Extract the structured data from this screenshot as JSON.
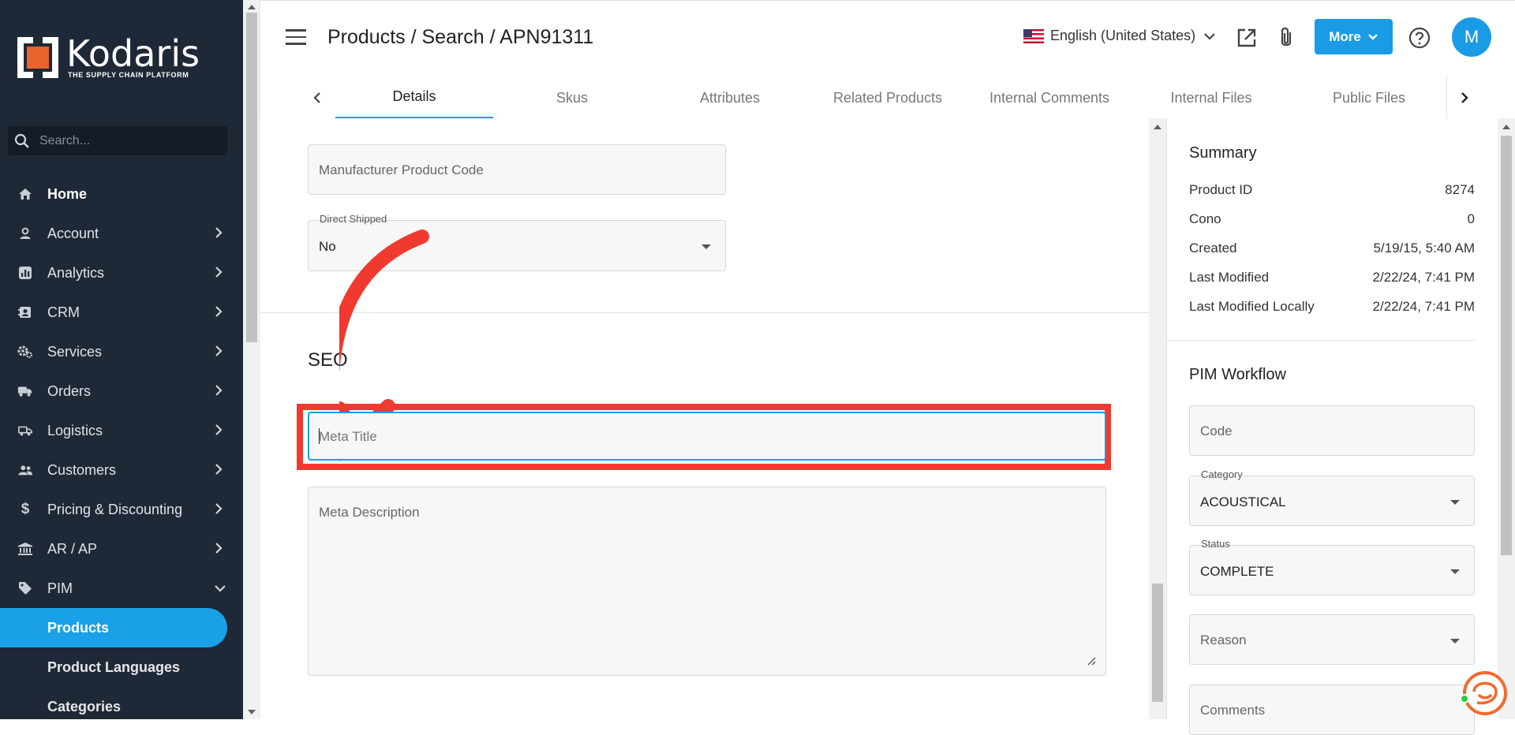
{
  "sidebar": {
    "brand": "Kodaris",
    "tagline": "THE SUPPLY CHAIN PLATFORM",
    "search_placeholder": "Search...",
    "items": [
      {
        "label": "Home",
        "icon": "home-icon"
      },
      {
        "label": "Account",
        "icon": "user-icon"
      },
      {
        "label": "Analytics",
        "icon": "analytics-icon"
      },
      {
        "label": "CRM",
        "icon": "crm-icon"
      },
      {
        "label": "Services",
        "icon": "gear-icon"
      },
      {
        "label": "Orders",
        "icon": "truck-icon"
      },
      {
        "label": "Logistics",
        "icon": "logistics-icon"
      },
      {
        "label": "Customers",
        "icon": "people-icon"
      },
      {
        "label": "Pricing & Discounting",
        "icon": "dollar-icon"
      },
      {
        "label": "AR / AP",
        "icon": "bank-icon"
      },
      {
        "label": "PIM",
        "icon": "tag-icon"
      }
    ],
    "pim_sub": [
      {
        "label": "Products"
      },
      {
        "label": "Product Languages"
      },
      {
        "label": "Categories"
      }
    ]
  },
  "header": {
    "title": "Products / Search / APN91311",
    "language": "English (United States)",
    "more_label": "More",
    "avatar_initial": "M"
  },
  "tabs": [
    "Details",
    "Skus",
    "Attributes",
    "Related Products",
    "Internal Comments",
    "Internal Files",
    "Public Files"
  ],
  "main": {
    "manufacturer_code_placeholder": "Manufacturer Product Code",
    "direct_shipped_label": "Direct Shipped",
    "direct_shipped_value": "No",
    "seo_heading": "SEO",
    "meta_title_placeholder": "Meta Title",
    "meta_description_placeholder": "Meta Description"
  },
  "summary": {
    "title": "Summary",
    "rows": [
      {
        "label": "Product ID",
        "value": "8274"
      },
      {
        "label": "Cono",
        "value": "0"
      },
      {
        "label": "Created",
        "value": "5/19/15, 5:40 AM"
      },
      {
        "label": "Last Modified",
        "value": "2/22/24, 7:41 PM"
      },
      {
        "label": "Last Modified Locally",
        "value": "2/22/24, 7:41 PM"
      }
    ]
  },
  "pim_workflow": {
    "title": "PIM Workflow",
    "code_placeholder": "Code",
    "category_label": "Category",
    "category_value": "ACOUSTICAL",
    "status_label": "Status",
    "status_value": "COMPLETE",
    "reason_placeholder": "Reason",
    "comments_placeholder": "Comments"
  },
  "colors": {
    "accent": "#1a9be6",
    "sidebar_bg": "#1f2836",
    "highlight": "#f03a30",
    "logo_orange": "#e8642c"
  }
}
